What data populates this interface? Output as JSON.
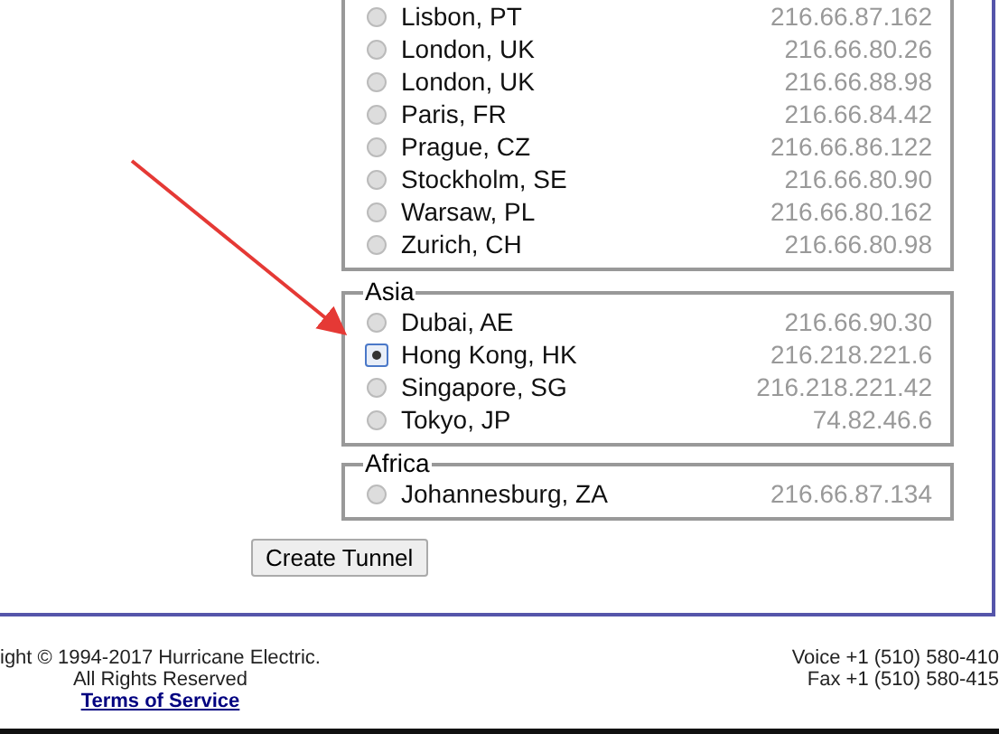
{
  "regions": [
    {
      "rows": [
        {
          "city": "Lisbon, PT",
          "ip": "216.66.87.162",
          "selected": false
        },
        {
          "city": "London, UK",
          "ip": "216.66.80.26",
          "selected": false
        },
        {
          "city": "London, UK",
          "ip": "216.66.88.98",
          "selected": false
        },
        {
          "city": "Paris, FR",
          "ip": "216.66.84.42",
          "selected": false
        },
        {
          "city": "Prague, CZ",
          "ip": "216.66.86.122",
          "selected": false
        },
        {
          "city": "Stockholm, SE",
          "ip": "216.66.80.90",
          "selected": false
        },
        {
          "city": "Warsaw, PL",
          "ip": "216.66.80.162",
          "selected": false
        },
        {
          "city": "Zurich, CH",
          "ip": "216.66.80.98",
          "selected": false
        }
      ]
    },
    {
      "legend": "Asia",
      "rows": [
        {
          "city": "Dubai, AE",
          "ip": "216.66.90.30",
          "selected": false
        },
        {
          "city": "Hong Kong, HK",
          "ip": "216.218.221.6",
          "selected": true
        },
        {
          "city": "Singapore, SG",
          "ip": "216.218.221.42",
          "selected": false
        },
        {
          "city": "Tokyo, JP",
          "ip": "74.82.46.6",
          "selected": false
        }
      ]
    },
    {
      "legend": "Africa",
      "rows": [
        {
          "city": "Johannesburg, ZA",
          "ip": "216.66.87.134",
          "selected": false
        }
      ]
    }
  ],
  "button": "Create Tunnel",
  "footer": {
    "left": [
      "ight © 1994-2017 Hurricane Electric.",
      "All Rights Reserved"
    ],
    "link": "Terms of Service",
    "right": [
      "Voice +1 (510) 580-410",
      "Fax +1 (510) 580-415"
    ]
  }
}
